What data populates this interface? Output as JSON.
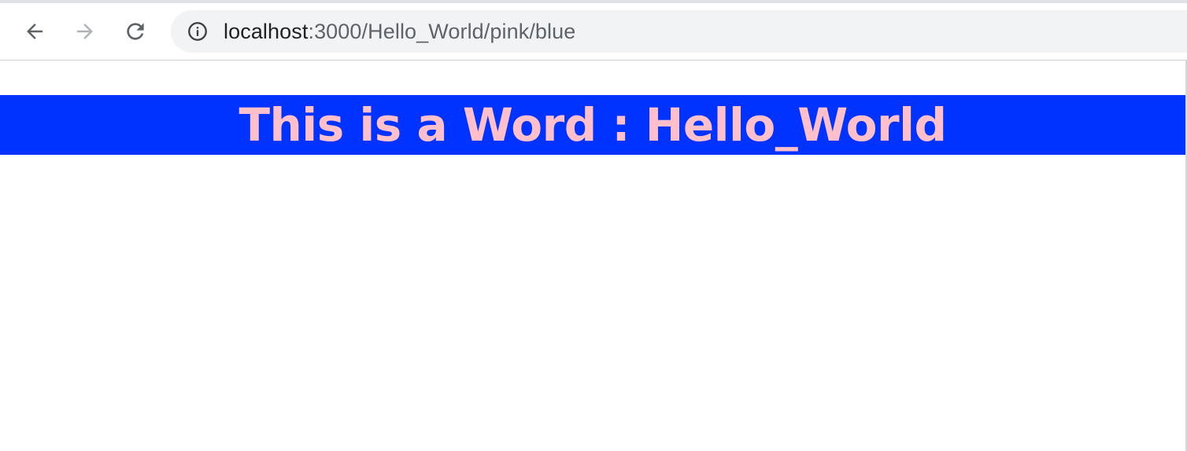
{
  "browser": {
    "url_host": "localhost",
    "url_path": ":3000/Hello_World/pink/blue",
    "icons": {
      "back": "arrow-left-icon",
      "forward": "arrow-right-icon",
      "reload": "reload-icon",
      "info": "info-icon"
    }
  },
  "page": {
    "heading": "This is a Word : Hello_World",
    "heading_color": "#ffc0cb",
    "banner_color": "#0033ff"
  }
}
